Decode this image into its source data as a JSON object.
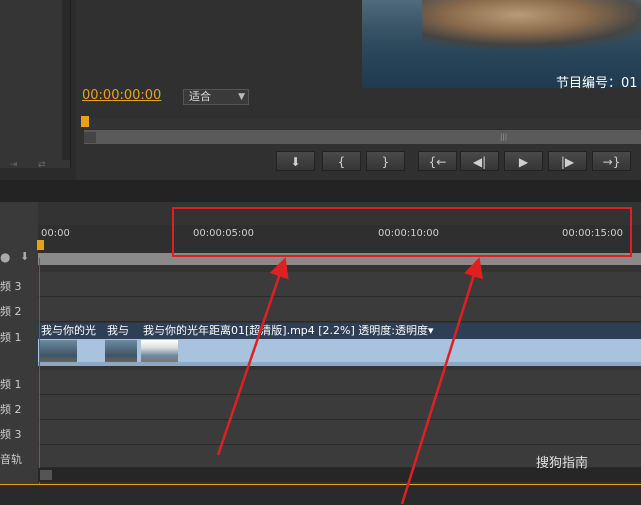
{
  "monitor": {
    "timecode": "00:00:00:00",
    "fit_label": "适合",
    "video_caption": "节目编号：01"
  },
  "controls": [
    "⬇",
    "{",
    "}",
    "{←",
    "◀|",
    "▶",
    "|▶",
    "→}"
  ],
  "ruler": {
    "ticks": [
      "00:00",
      "00:00:05:00",
      "00:00:10:00",
      "00:00:15:00"
    ]
  },
  "tracks": {
    "labels": [
      "频 3",
      "频 2",
      "频 1",
      "频 1",
      "频 2",
      "频 3",
      "音轨"
    ]
  },
  "clips": {
    "clip1_title": "我与你的光",
    "clip2_title": "我与",
    "clip3_title": "我与你的光年距离01[超清版].mp4 [2.2%] 透明度:透明度▾"
  },
  "watermark": "搜狗指南",
  "colors": {
    "timecode": "#e8a21a",
    "highlight": "#e02020",
    "clip": "#a9c2de"
  }
}
